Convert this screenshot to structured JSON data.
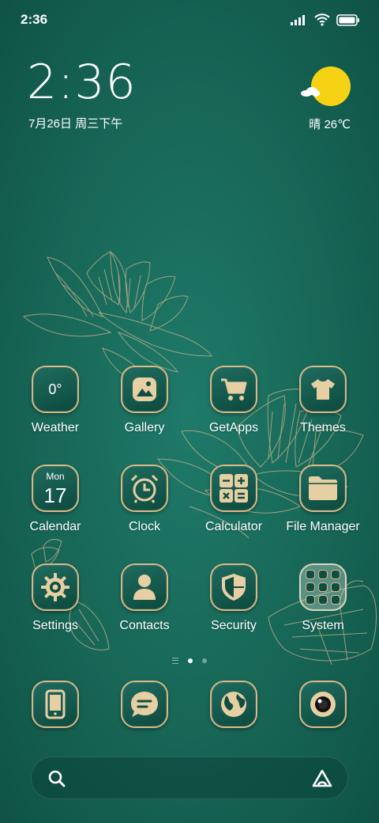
{
  "status_bar": {
    "time": "2:36"
  },
  "clock": {
    "time": "2:36",
    "date": "7月26日 周三下午"
  },
  "weather": {
    "text": "晴 26℃"
  },
  "apps": [
    {
      "label": "Weather",
      "icon": "weather-icon",
      "value": "0°"
    },
    {
      "label": "Gallery",
      "icon": "gallery-icon"
    },
    {
      "label": "GetApps",
      "icon": "cart-icon"
    },
    {
      "label": "Themes",
      "icon": "tshirt-icon"
    },
    {
      "label": "Calendar",
      "icon": "calendar-icon",
      "weekday": "Mon",
      "day": "17"
    },
    {
      "label": "Clock",
      "icon": "alarm-clock-icon"
    },
    {
      "label": "Calculator",
      "icon": "calculator-icon"
    },
    {
      "label": "File Manager",
      "icon": "folder-icon"
    },
    {
      "label": "Settings",
      "icon": "gear-icon"
    },
    {
      "label": "Contacts",
      "icon": "person-icon"
    },
    {
      "label": "Security",
      "icon": "shield-icon"
    },
    {
      "label": "System",
      "icon": "app-folder-icon"
    }
  ],
  "dock": [
    {
      "icon": "phone-icon"
    },
    {
      "icon": "message-icon"
    },
    {
      "icon": "browser-globe-icon"
    },
    {
      "icon": "camera-icon"
    }
  ],
  "page_indicator": {
    "pages": 2,
    "current": 1
  },
  "search": {
    "icon": "search-icon",
    "assistant_icon": "assistant-logo-icon"
  },
  "colors": {
    "background": "#176656",
    "icon_gold": "#d8b887",
    "sun": "#f6d214"
  }
}
